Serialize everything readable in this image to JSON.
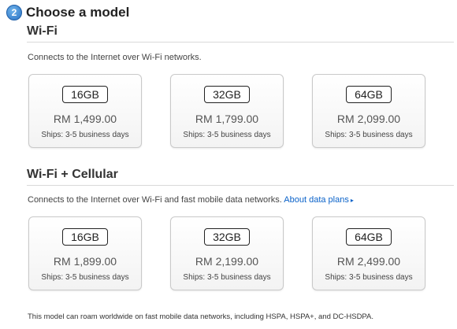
{
  "step": {
    "number": "2",
    "title": "Choose a model"
  },
  "wifi": {
    "title": "Wi-Fi",
    "description": "Connects to the Internet over Wi-Fi networks.",
    "options": [
      {
        "capacity": "16GB",
        "price": "RM 1,499.00",
        "ships": "Ships: 3-5 business days"
      },
      {
        "capacity": "32GB",
        "price": "RM 1,799.00",
        "ships": "Ships: 3-5 business days"
      },
      {
        "capacity": "64GB",
        "price": "RM 2,099.00",
        "ships": "Ships: 3-5 business days"
      }
    ]
  },
  "cellular": {
    "title": "Wi-Fi + Cellular",
    "description": "Connects to the Internet over Wi-Fi and fast mobile data networks.",
    "link": "About data plans",
    "options": [
      {
        "capacity": "16GB",
        "price": "RM 1,899.00",
        "ships": "Ships: 3-5 business days"
      },
      {
        "capacity": "32GB",
        "price": "RM 2,199.00",
        "ships": "Ships: 3-5 business days"
      },
      {
        "capacity": "64GB",
        "price": "RM 2,499.00",
        "ships": "Ships: 3-5 business days"
      }
    ]
  },
  "footnote": "This model can roam worldwide on fast mobile data networks, including HSPA, HSPA+, and DC-HSDPA.",
  "colors": {
    "link": "#0a62c9",
    "step_badge": "#2a72c4"
  }
}
